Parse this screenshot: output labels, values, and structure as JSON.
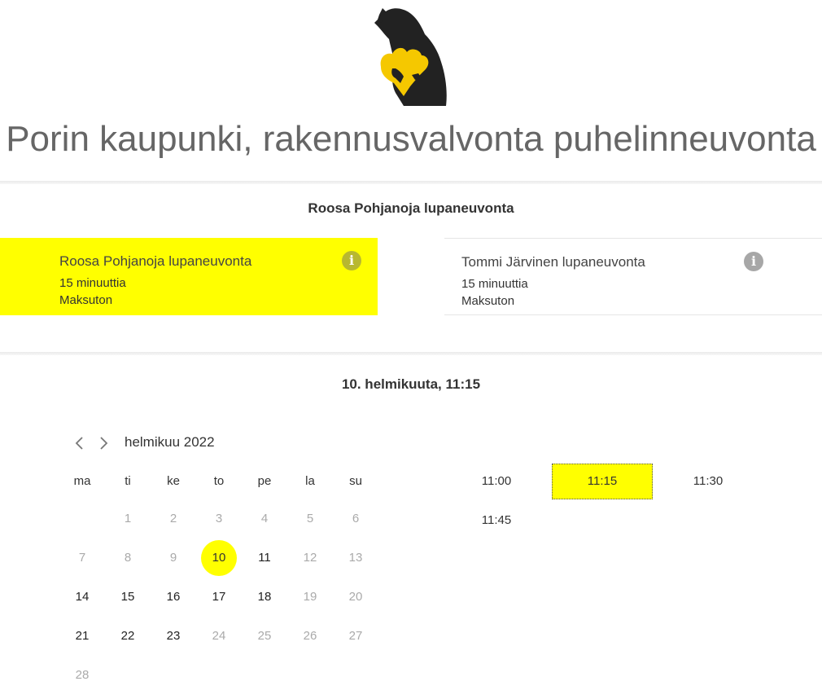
{
  "header": {
    "logo_name": "bear-heart-logo",
    "title": "Porin kaupunki, rakennusvalvonta puhelinneuvonta"
  },
  "service_section": {
    "heading": "Roosa Pohjanoja lupaneuvonta",
    "services": [
      {
        "name": "Roosa Pohjanoja lupaneuvonta",
        "duration": "15 minuuttia",
        "price": "Maksuton",
        "selected": true,
        "info_icon": "info-icon"
      },
      {
        "name": "Tommi Järvinen lupaneuvonta",
        "duration": "15 minuuttia",
        "price": "Maksuton",
        "selected": false,
        "info_icon": "info-icon"
      }
    ]
  },
  "date_section": {
    "heading": "10. helmikuuta, 11:15"
  },
  "calendar": {
    "prev_icon": "chevron-left-icon",
    "next_icon": "chevron-right-icon",
    "month_label": "helmikuu 2022",
    "weekdays": [
      "ma",
      "ti",
      "ke",
      "to",
      "pe",
      "la",
      "su"
    ],
    "days": [
      "1",
      "2",
      "3",
      "4",
      "5",
      "6",
      "7",
      "8",
      "9",
      "10",
      "11",
      "12",
      "13",
      "14",
      "15",
      "16",
      "17",
      "18",
      "19",
      "20",
      "21",
      "22",
      "23",
      "24",
      "25",
      "26",
      "27",
      "28"
    ],
    "first_weekday_index": 1,
    "available_days": [
      "10",
      "11",
      "14",
      "15",
      "16",
      "17",
      "18",
      "21",
      "22",
      "23"
    ],
    "selected_day": "10"
  },
  "time_slots": {
    "slots": [
      "11:00",
      "11:15",
      "11:30",
      "11:45"
    ],
    "selected": "11:15"
  },
  "colors": {
    "accent": "#ffff00",
    "title_gray": "#666666",
    "logo_black": "#222222",
    "logo_heart": "#f5c800"
  }
}
